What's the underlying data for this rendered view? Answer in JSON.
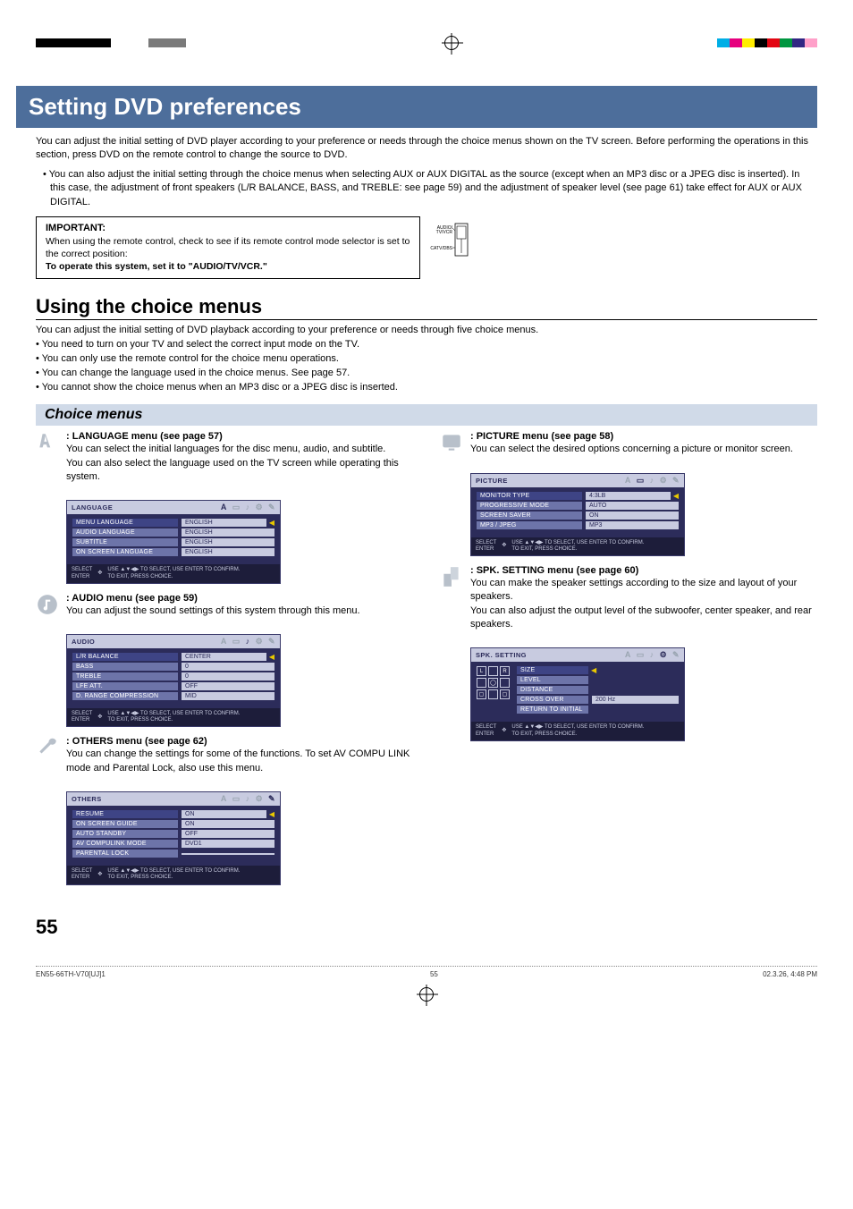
{
  "header": {
    "title": "Setting DVD preferences"
  },
  "intro": {
    "p1": "You can adjust the initial setting of DVD player according to your preference or needs through the choice menus shown on the TV screen. Before performing the operations in this section, press DVD on the remote control to change the source to DVD.",
    "bullet": "• You can also adjust the initial setting through the choice menus when selecting AUX or AUX DIGITAL as the source (except when an MP3 disc or a JPEG disc is inserted). In this case, the adjustment of front speakers (L/R BALANCE, BASS, and TREBLE: see page 59) and the adjustment of speaker level (see page 61) take effect for AUX or AUX DIGITAL."
  },
  "important": {
    "title": "IMPORTANT:",
    "body": "When using the remote control, check to see if its remote control mode selector is set to the correct position:",
    "bold": "To operate this system, set it to \"AUDIO/TV/VCR.\"",
    "switch_top": "AUDIO/\nTV/VCR",
    "switch_bottom": "CATV/DBS"
  },
  "choice_section": {
    "heading": "Using the choice menus",
    "lead": "You can adjust the initial setting of DVD playback according to your preference or needs through five choice menus.",
    "bullets": [
      "• You need to turn on your TV and select the correct input mode on the TV.",
      "• You can only use the remote control for the choice menu operations.",
      "• You can change the language used in the choice menus. See page 57.",
      "• You cannot show the choice menus when an MP3 disc or a JPEG disc is inserted."
    ],
    "subhead": "Choice menus"
  },
  "menus": {
    "language": {
      "title": ": LANGUAGE menu (see page 57)",
      "desc": "You can select the initial languages for the disc menu, audio, and subtitle.\nYou can also select the language used on the TV screen while operating this system.",
      "osd_title": "LANGUAGE",
      "rows": [
        {
          "label": "MENU LANGUAGE",
          "val": "ENGLISH",
          "sel": true
        },
        {
          "label": "AUDIO LANGUAGE",
          "val": "ENGLISH"
        },
        {
          "label": "SUBTITLE",
          "val": "ENGLISH"
        },
        {
          "label": "ON SCREEN LANGUAGE",
          "val": "ENGLISH"
        }
      ]
    },
    "audio": {
      "title": ": AUDIO menu (see page 59)",
      "desc": "You can adjust the sound settings of this system through this menu.",
      "osd_title": "AUDIO",
      "rows": [
        {
          "label": "L/R BALANCE",
          "val": "CENTER",
          "sel": true
        },
        {
          "label": "BASS",
          "val": "0"
        },
        {
          "label": "TREBLE",
          "val": "0"
        },
        {
          "label": "LFE ATT.",
          "val": "OFF"
        },
        {
          "label": "D. RANGE COMPRESSION",
          "val": "MID"
        }
      ]
    },
    "others": {
      "title": ": OTHERS menu (see page 62)",
      "desc": "You can change the settings for some of the functions. To set AV COMPU LINK mode and Parental Lock, also use this menu.",
      "osd_title": "OTHERS",
      "rows": [
        {
          "label": "RESUME",
          "val": "ON",
          "sel": true
        },
        {
          "label": "ON SCREEN GUIDE",
          "val": "ON"
        },
        {
          "label": "AUTO STANDBY",
          "val": "OFF"
        },
        {
          "label": "AV COMPULINK MODE",
          "val": "DVD1"
        },
        {
          "label": "PARENTAL LOCK",
          "val": ""
        }
      ]
    },
    "picture": {
      "title": ": PICTURE menu (see page 58)",
      "desc": "You can select the desired options concerning a picture or monitor screen.",
      "osd_title": "PICTURE",
      "rows": [
        {
          "label": "MONITOR TYPE",
          "val": "4:3LB",
          "sel": true
        },
        {
          "label": "PROGRESSIVE MODE",
          "val": "AUTO"
        },
        {
          "label": "SCREEN SAVER",
          "val": "ON"
        },
        {
          "label": "MP3 / JPEG",
          "val": "MP3"
        }
      ]
    },
    "spk": {
      "title": ": SPK. SETTING menu (see page 60)",
      "desc": "You can make the speaker settings according to the size and layout of your speakers.\nYou can also adjust the output level of the subwoofer, center speaker, and rear speakers.",
      "osd_title": "SPK. SETTING",
      "rows": [
        {
          "label": "SIZE",
          "sel": true
        },
        {
          "label": "LEVEL"
        },
        {
          "label": "DISTANCE"
        },
        {
          "label": "CROSS OVER",
          "val": "200 Hz"
        },
        {
          "label": "RETURN TO INITIAL"
        }
      ]
    },
    "osd_footer": {
      "select": "SELECT",
      "enter": "ENTER",
      "help1": "USE ▲▼◀▶ TO SELECT,  USE ENTER TO CONFIRM.",
      "help2": "TO EXIT, PRESS CHOICE."
    }
  },
  "page_number": "55",
  "footer": {
    "left": "EN55-66TH-V70[UJ]1",
    "mid": "55",
    "right": "02.3.26, 4:48 PM"
  },
  "colors": {
    "strip_dark": [
      "#000",
      "#000",
      "#000",
      "#000",
      "#000",
      "#000",
      "#fff",
      "#fff",
      "#fff",
      "#7a7a7a",
      "#7a7a7a",
      "#7a7a7a"
    ],
    "strip_cmyk": [
      "#00aee6",
      "#e6007e",
      "#ffed00",
      "#000",
      "#e30613",
      "#009640",
      "#312783",
      "#ffa0c9"
    ]
  }
}
